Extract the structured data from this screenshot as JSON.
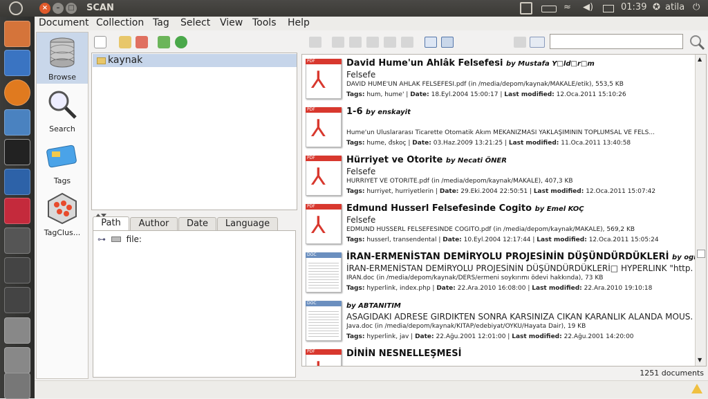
{
  "topbar": {
    "app_title": "SCAN",
    "time": "01:39",
    "user": "atila"
  },
  "menu": [
    "Document",
    "Collection",
    "Tag",
    "Select",
    "View",
    "Tools",
    "Help"
  ],
  "sidebar": [
    {
      "label": "Browse",
      "icon": "database-icon",
      "active": true
    },
    {
      "label": "Search",
      "icon": "magnifier-icon",
      "active": false
    },
    {
      "label": "Tags",
      "icon": "tag-card-icon",
      "active": false
    },
    {
      "label": "TagClus...",
      "icon": "tag-cluster-icon",
      "active": false
    }
  ],
  "tree": {
    "selected_folder": "kaynak"
  },
  "facet_tabs": [
    "Path",
    "Author",
    "Date",
    "Language"
  ],
  "facet_tree": {
    "root": "file:"
  },
  "results": [
    {
      "type": "PDF",
      "title": "David Hume'un Ahlâk Felsefesi",
      "by": "by Mustafa Y□ld□r□m",
      "subtitle": "Felsefe",
      "path": "DAVID HUME'UN AHLÂK FELSEFESİ.pdf (in /media/depom/kaynak/MAKALE/etik), 553,5 KB",
      "tags": "hum, hume'",
      "date": "18.Eyl.2004 15:00:17",
      "modified": "12.Oca.2011 15:10:26"
    },
    {
      "type": "PDF",
      "title": "1-6",
      "by": "by enskayit",
      "subtitle": "",
      "path": "Hume'un Uluslararası Ticarette Otomatik Akım MEKANİZMASI YAKLAŞIMININ TOPLUMSAL VE FELS...",
      "tags": "hume, đskoç",
      "date": "03.Haz.2009 13:21:25",
      "modified": "11.Oca.2011 13:40:58"
    },
    {
      "type": "PDF",
      "title": "Hürriyet ve Otorite",
      "by": "by Necati ÖNER",
      "subtitle": "Felsefe",
      "path": "HÜRRİYET VE OTORİTE.pdf (in /media/depom/kaynak/MAKALE), 407,3 KB",
      "tags": "hurriyet, hurriyetlerin",
      "date": "29.Eki.2004 22:50:51",
      "modified": "12.Oca.2011 15:07:42"
    },
    {
      "type": "PDF",
      "title": "Edmund Husserl Felsefesinde Cogito",
      "by": "by Emel KOÇ",
      "subtitle": "Felsefe",
      "path": "EDMUND HUSSERL FELSEFESİNDE COGİTO.pdf (in /media/depom/kaynak/MAKALE), 569,2 KB",
      "tags": "husserl, transendental",
      "date": "10.Eyl.2004 12:17:44",
      "modified": "12.Oca.2011 15:05:24"
    },
    {
      "type": "DOC",
      "title": "İRAN-ERMENİSTAN DEMİRYOLU PROJESİNİN DÜŞÜNDÜRDÜKLERİ",
      "by": "by ogrenci.",
      "subtitle": "İRAN-ERMENİSTAN DEMİRYOLU PROJESİNİN DÜŞÜNDÜRDÜKLERİ□ HYPERLINK \"http...",
      "path": "İRAN.doc (in /media/depom/kaynak/DERS/ermeni soykırımı ödevi hakkında), 73 KB",
      "tags": "hyperlink, index.php",
      "date": "22.Ara.2010 16:08:00",
      "modified": "22.Ara.2010 19:10:18"
    },
    {
      "type": "DOC",
      "title": "",
      "by": "by ABTANITIM",
      "subtitle": "ASAGIDAKI ADRESE GIRDIKTEN SONRA KARSINIZA CIKAN KARANLIK ALANDA MOUS...",
      "path": "Java.doc (in /media/depom/kaynak/KİTAP/edebiyat/ÖYKÜ/Hayata Dair), 19 KB",
      "tags": "hyperlink, jav",
      "date": "22.Ağu.2001 12:01:00",
      "modified": "22.Ağu.2001 14:20:00"
    },
    {
      "type": "PDF",
      "title": "DİNİN NESNELLEŞMESİ",
      "by": "",
      "subtitle": "",
      "path": "",
      "tags": "",
      "date": "",
      "modified": ""
    }
  ],
  "labels": {
    "tags": "Tags:",
    "date": "Date:",
    "modified": "Last modified:"
  },
  "status": "1251 documents",
  "colors": {
    "accent": "#c9d7ea",
    "pdf_red": "#d8382e",
    "topbar": "#3c3b37"
  }
}
